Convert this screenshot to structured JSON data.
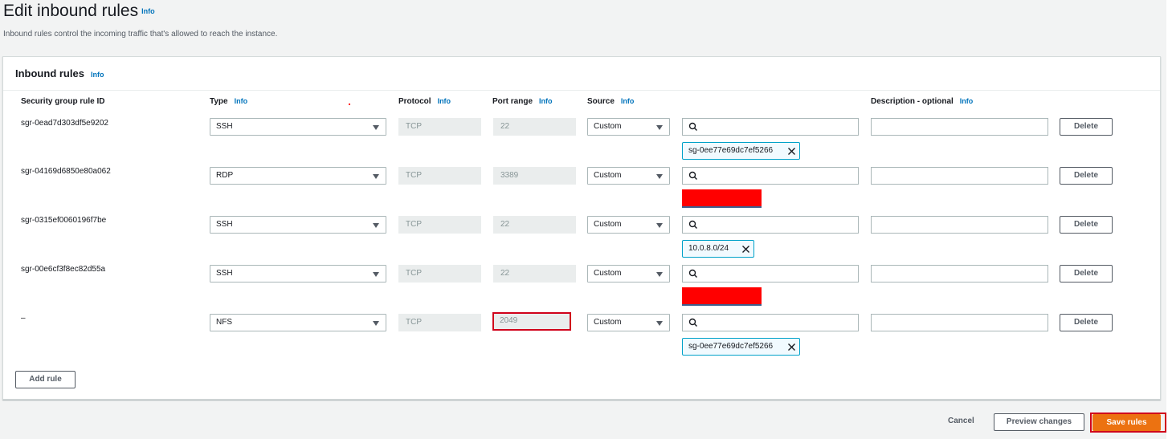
{
  "header": {
    "title": "Edit inbound rules",
    "info": "Info",
    "description": "Inbound rules control the incoming traffic that's allowed to reach the instance."
  },
  "panel": {
    "title": "Inbound rules",
    "info": "Info",
    "columns": {
      "rule_id": "Security group rule ID",
      "type": "Type",
      "protocol": "Protocol",
      "port_range": "Port range",
      "source": "Source",
      "description": "Description - optional",
      "info": "Info"
    }
  },
  "rules": [
    {
      "id": "sgr-0ead7d303df5e9202",
      "type": "SSH",
      "protocol": "TCP",
      "port": "22",
      "source": "Custom",
      "search": "",
      "description": "",
      "delete": "Delete",
      "token": "sg-0ee77e69dc7ef5266",
      "redacted": false
    },
    {
      "id": "sgr-04169d6850e80a062",
      "type": "RDP",
      "protocol": "TCP",
      "port": "3389",
      "source": "Custom",
      "search": "",
      "description": "",
      "delete": "Delete",
      "token": "",
      "redacted": true
    },
    {
      "id": "sgr-0315ef0060196f7be",
      "type": "SSH",
      "protocol": "TCP",
      "port": "22",
      "source": "Custom",
      "search": "",
      "description": "",
      "delete": "Delete",
      "token": "10.0.8.0/24",
      "redacted": false
    },
    {
      "id": "sgr-00e6cf3f8ec82d55a",
      "type": "SSH",
      "protocol": "TCP",
      "port": "22",
      "source": "Custom",
      "search": "",
      "description": "",
      "delete": "Delete",
      "token": "",
      "redacted": true
    },
    {
      "id": "–",
      "type": "NFS",
      "protocol": "TCP",
      "port": "2049",
      "source": "Custom",
      "search": "",
      "description": "",
      "delete": "Delete",
      "token": "sg-0ee77e69dc7ef5266",
      "redacted": false
    }
  ],
  "actions": {
    "add_rule": "Add rule",
    "cancel": "Cancel",
    "preview": "Preview changes",
    "save": "Save rules"
  },
  "icons": {
    "search": "search-icon",
    "remove": "close-icon",
    "dropdown": "caret-down-icon"
  },
  "colors": {
    "link": "#0073bb",
    "primary": "#ec7211",
    "highlight": "#d0021b",
    "redaction": "#ff0000",
    "token_border": "#00a1c9"
  }
}
